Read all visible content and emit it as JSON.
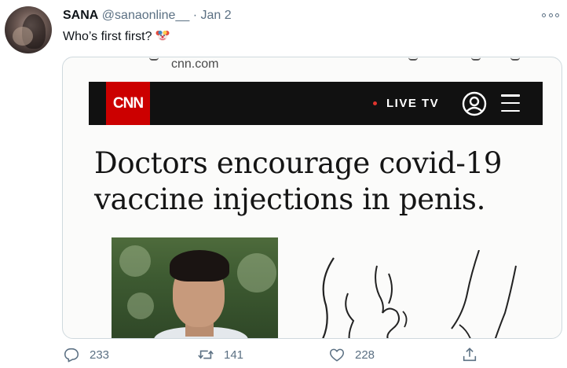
{
  "tweet": {
    "author_name": "SANA",
    "author_handle": "@sanaonline__",
    "separator": "·",
    "date": "Jan 2",
    "text": "Who’s first first?"
  },
  "media": {
    "url": "cnn.com",
    "brand_logo": "CNN",
    "live_label": "LIVE TV",
    "headline_line1": "Doctors encourage covid-19",
    "headline_line2": "vaccine injections in penis."
  },
  "actions": {
    "replies": "233",
    "retweets": "141",
    "likes": "228"
  },
  "colors": {
    "muted": "#5b7083",
    "cnn_red": "#cc0000",
    "cnn_bar": "#111111",
    "border": "#cfd9de"
  },
  "icons": [
    "more-icon",
    "clown-emoji",
    "account-icon",
    "hamburger-menu-icon",
    "reply-icon",
    "retweet-icon",
    "like-icon",
    "share-icon"
  ]
}
